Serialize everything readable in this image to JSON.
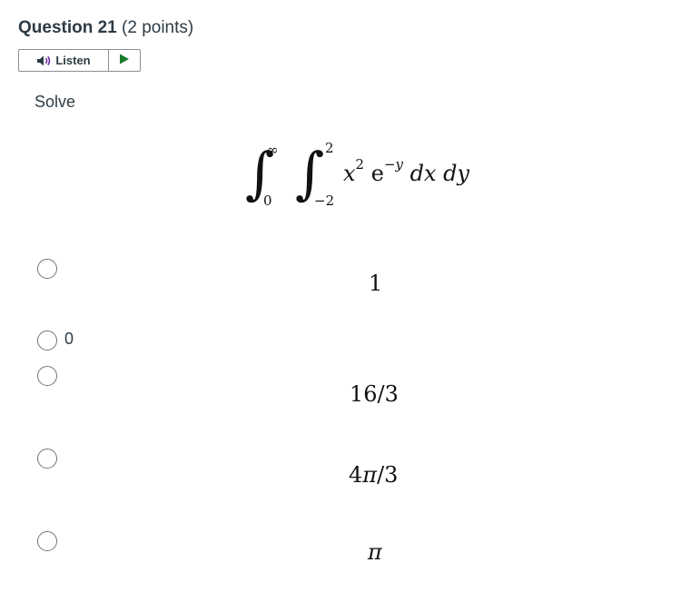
{
  "question": {
    "title": "Question 21",
    "points": "(2 points)"
  },
  "listen": {
    "label": "Listen",
    "speaker_icon": "speaker-icon",
    "play_icon": "play-icon"
  },
  "prompt": "Solve",
  "integral": {
    "outer_upper": "∞",
    "outer_lower": "0",
    "inner_upper": "2",
    "inner_lower": "−2",
    "base_x": "x",
    "exp_x": "2",
    "base_e": "e",
    "exp_e": "−y",
    "differentials": "dx dy"
  },
  "choices": [
    {
      "label": "1",
      "pi": ""
    },
    {
      "label": "0"
    },
    {
      "label": "16/3"
    },
    {
      "label_num": "4",
      "label_pi": "π",
      "label_den": "/3"
    },
    {
      "label": "π"
    }
  ],
  "colors": {
    "text": "#2d3b45",
    "math": "#111111",
    "border": "#8a8f93",
    "play": "#2d3b45"
  }
}
